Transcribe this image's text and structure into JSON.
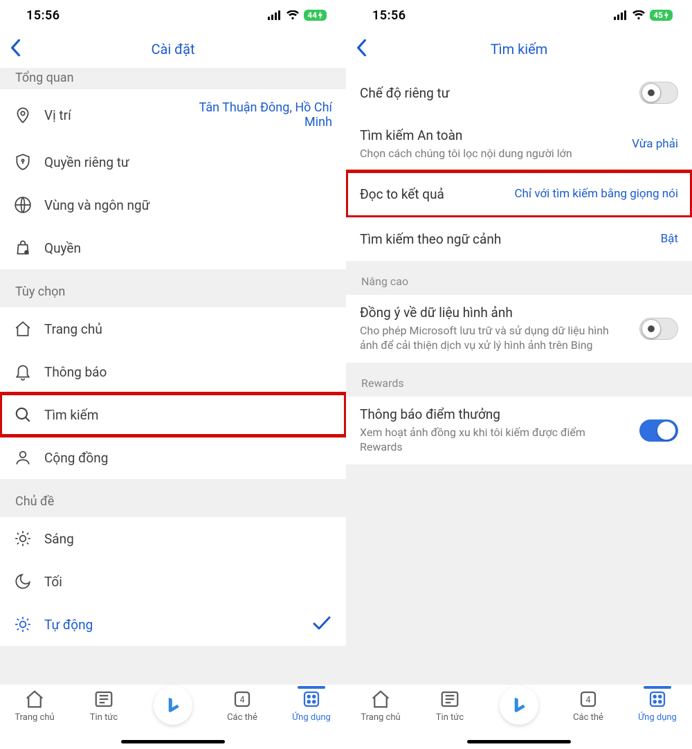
{
  "left": {
    "status": {
      "time": "15:56",
      "battery": "44"
    },
    "header": {
      "title": "Cài đặt"
    },
    "truncated_top": "Tổng quan",
    "rows": {
      "location": {
        "label": "Vị trí",
        "value": "Tân Thuận Đông, Hồ Chí Minh"
      },
      "privacy": {
        "label": "Quyền riêng tư"
      },
      "region": {
        "label": "Vùng và ngôn ngữ"
      },
      "perm": {
        "label": "Quyền"
      }
    },
    "section_options": "Tùy chọn",
    "opt": {
      "home": {
        "label": "Trang chủ"
      },
      "notif": {
        "label": "Thông báo"
      },
      "search": {
        "label": "Tìm kiếm"
      },
      "community": {
        "label": "Cộng đồng"
      }
    },
    "section_theme": "Chủ đề",
    "theme": {
      "light": {
        "label": "Sáng"
      },
      "dark": {
        "label": "Tối"
      },
      "auto": {
        "label": "Tự động"
      }
    }
  },
  "right": {
    "status": {
      "time": "15:56",
      "battery": "45"
    },
    "header": {
      "title": "Tìm kiếm"
    },
    "rows": {
      "private": {
        "title": "Chế độ riêng tư"
      },
      "safesearch": {
        "title": "Tìm kiếm An toàn",
        "sub": "Chọn cách chúng tôi lọc nội dung người lớn",
        "value": "Vừa phải"
      },
      "read": {
        "title": "Đọc to kết quả",
        "value": "Chỉ với tìm kiếm bằng giọng nói"
      },
      "context": {
        "title": "Tìm kiếm theo ngữ cảnh",
        "value": "Bật"
      }
    },
    "section_adv": "Nâng cao",
    "adv": {
      "image": {
        "title": "Đồng ý về dữ liệu hình ảnh",
        "sub": "Cho phép Microsoft lưu trữ và sử dụng dữ liệu hình ảnh để cải thiện dịch vụ xử lý hình ảnh trên Bing"
      }
    },
    "section_rewards": "Rewards",
    "rewards": {
      "notif": {
        "title": "Thông báo điểm thưởng",
        "sub": "Xem hoạt ảnh đồng xu khi tôi kiếm được điểm Rewards"
      }
    }
  },
  "tabs": {
    "home": "Trang chủ",
    "news": "Tin tức",
    "cards": "Các thẻ",
    "cards_count": "4",
    "apps": "Ứng dụng"
  }
}
